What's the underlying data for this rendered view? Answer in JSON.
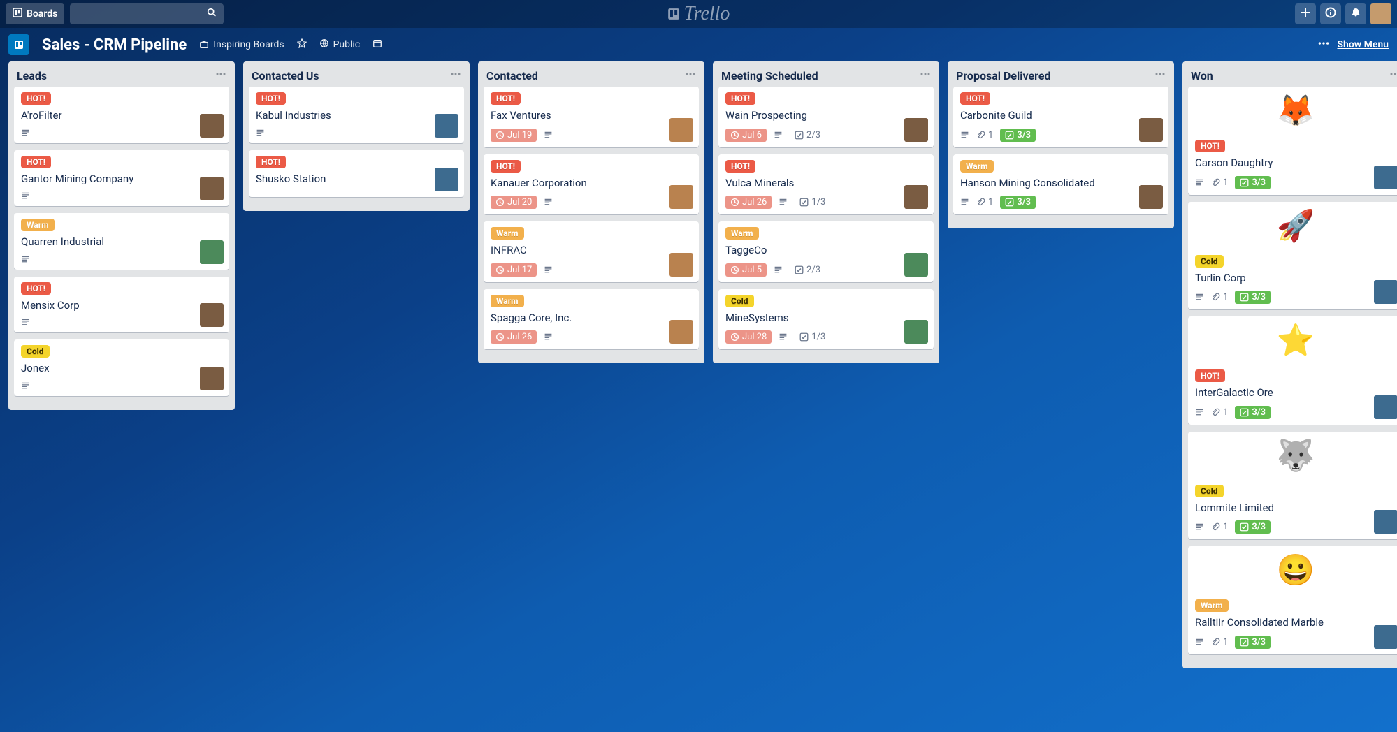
{
  "header": {
    "boards_label": "Boards",
    "logo_text": "Trello"
  },
  "boardbar": {
    "title": "Sales - CRM Pipeline",
    "inspiring": "Inspiring Boards",
    "visibility": "Public",
    "show_menu": "Show Menu"
  },
  "labels": {
    "hot": "HOT!",
    "warm": "Warm",
    "cold": "Cold"
  },
  "lists": [
    {
      "title": "Leads",
      "cards": [
        {
          "labels": [
            "hot"
          ],
          "title": "A'roFilter",
          "badges": {
            "desc": true
          },
          "avatar": "ava-3"
        },
        {
          "labels": [
            "hot"
          ],
          "title": "Gantor Mining Company",
          "badges": {
            "desc": true
          },
          "avatar": "ava-3"
        },
        {
          "labels": [
            "warm"
          ],
          "title": "Quarren Industrial",
          "badges": {
            "desc": true
          },
          "avatar": "ava-4"
        },
        {
          "labels": [
            "hot"
          ],
          "title": "Mensix Corp",
          "badges": {
            "desc": true
          },
          "avatar": "ava-3"
        },
        {
          "labels": [
            "cold"
          ],
          "title": "Jonex",
          "badges": {
            "desc": true
          },
          "avatar": "ava-3"
        }
      ]
    },
    {
      "title": "Contacted Us",
      "cards": [
        {
          "labels": [
            "hot"
          ],
          "title": "Kabul Industries",
          "badges": {
            "desc": true
          },
          "avatar": "ava-2"
        },
        {
          "labels": [
            "hot"
          ],
          "title": "Shusko Station",
          "badges": {},
          "avatar": "ava-2"
        }
      ]
    },
    {
      "title": "Contacted",
      "cards": [
        {
          "labels": [
            "hot"
          ],
          "title": "Fax Ventures",
          "badges": {
            "due": "Jul 19",
            "desc": true
          },
          "avatar": "ava-1"
        },
        {
          "labels": [
            "hot"
          ],
          "title": "Kanauer Corporation",
          "badges": {
            "due": "Jul 20",
            "desc": true
          },
          "avatar": "ava-1"
        },
        {
          "labels": [
            "warm"
          ],
          "title": "INFRAC",
          "badges": {
            "due": "Jul 17",
            "desc": true
          },
          "avatar": "ava-1"
        },
        {
          "labels": [
            "warm"
          ],
          "title": "Spagga Core, Inc.",
          "badges": {
            "due": "Jul 26",
            "desc": true
          },
          "avatar": "ava-1"
        }
      ]
    },
    {
      "title": "Meeting Scheduled",
      "cards": [
        {
          "labels": [
            "hot"
          ],
          "title": "Wain Prospecting",
          "badges": {
            "due": "Jul 6",
            "desc": true,
            "check_plain": "2/3"
          },
          "avatar": "ava-3"
        },
        {
          "labels": [
            "hot"
          ],
          "title": "Vulca Minerals",
          "badges": {
            "due": "Jul 26",
            "desc": true,
            "check_plain": "1/3"
          },
          "avatar": "ava-3"
        },
        {
          "labels": [
            "warm"
          ],
          "title": "TaggeCo",
          "badges": {
            "due": "Jul 5",
            "desc": true,
            "check_plain": "2/3"
          },
          "avatar": "ava-4"
        },
        {
          "labels": [
            "cold"
          ],
          "title": "MineSystems",
          "badges": {
            "due": "Jul 28",
            "desc": true,
            "check_plain": "1/3"
          },
          "avatar": "ava-4"
        }
      ]
    },
    {
      "title": "Proposal Delivered",
      "cards": [
        {
          "labels": [
            "hot"
          ],
          "title": "Carbonite Guild",
          "badges": {
            "desc": true,
            "attach": "1",
            "check": "3/3"
          },
          "avatar": "ava-3"
        },
        {
          "labels": [
            "warm"
          ],
          "title": "Hanson Mining Consolidated",
          "badges": {
            "desc": true,
            "attach": "1",
            "check": "3/3"
          },
          "avatar": "ava-3"
        }
      ]
    },
    {
      "title": "Won",
      "cards": [
        {
          "cover": "🦊",
          "labels": [
            "hot"
          ],
          "title": "Carson Daughtry",
          "badges": {
            "desc": true,
            "attach": "1",
            "check": "3/3"
          },
          "avatar": "ava-2"
        },
        {
          "cover": "🚀",
          "labels": [
            "cold"
          ],
          "title": "Turlin Corp",
          "badges": {
            "desc": true,
            "attach": "1",
            "check": "3/3"
          },
          "avatar": "ava-2"
        },
        {
          "cover": "⭐",
          "labels": [
            "hot"
          ],
          "title": "InterGalactic Ore",
          "badges": {
            "desc": true,
            "attach": "1",
            "check": "3/3"
          },
          "avatar": "ava-2"
        },
        {
          "cover": "🐺",
          "labels": [
            "cold"
          ],
          "title": "Lommite Limited",
          "badges": {
            "desc": true,
            "attach": "1",
            "check": "3/3"
          },
          "avatar": "ava-2"
        },
        {
          "cover": "😀",
          "labels": [
            "warm"
          ],
          "title": "Ralltiir Consolidated Marble",
          "badges": {
            "desc": true,
            "attach": "1",
            "check": "3/3"
          },
          "avatar": "ava-2"
        }
      ]
    }
  ]
}
